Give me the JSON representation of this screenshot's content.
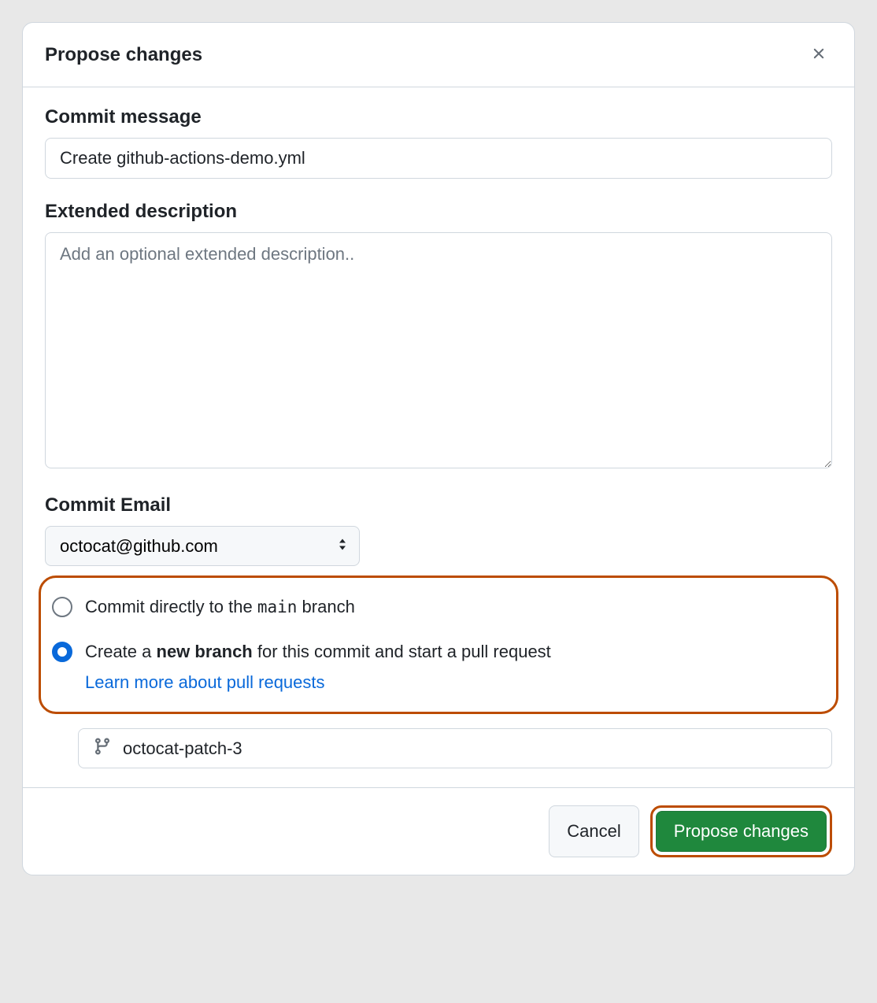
{
  "dialog": {
    "title": "Propose changes"
  },
  "commit_message": {
    "label": "Commit message",
    "value": "Create github-actions-demo.yml"
  },
  "extended_description": {
    "label": "Extended description",
    "placeholder": "Add an optional extended description..",
    "value": ""
  },
  "commit_email": {
    "label": "Commit Email",
    "value": "octocat@github.com"
  },
  "radio": {
    "direct_pre": "Commit directly to the ",
    "direct_branch": "main",
    "direct_post": " branch",
    "new_pre": "Create a ",
    "new_bold": "new branch",
    "new_post": " for this commit and start a pull request",
    "learn_more": "Learn more about pull requests",
    "selected": "new"
  },
  "branch_input": {
    "value": "octocat-patch-3"
  },
  "footer": {
    "cancel": "Cancel",
    "submit": "Propose changes"
  }
}
